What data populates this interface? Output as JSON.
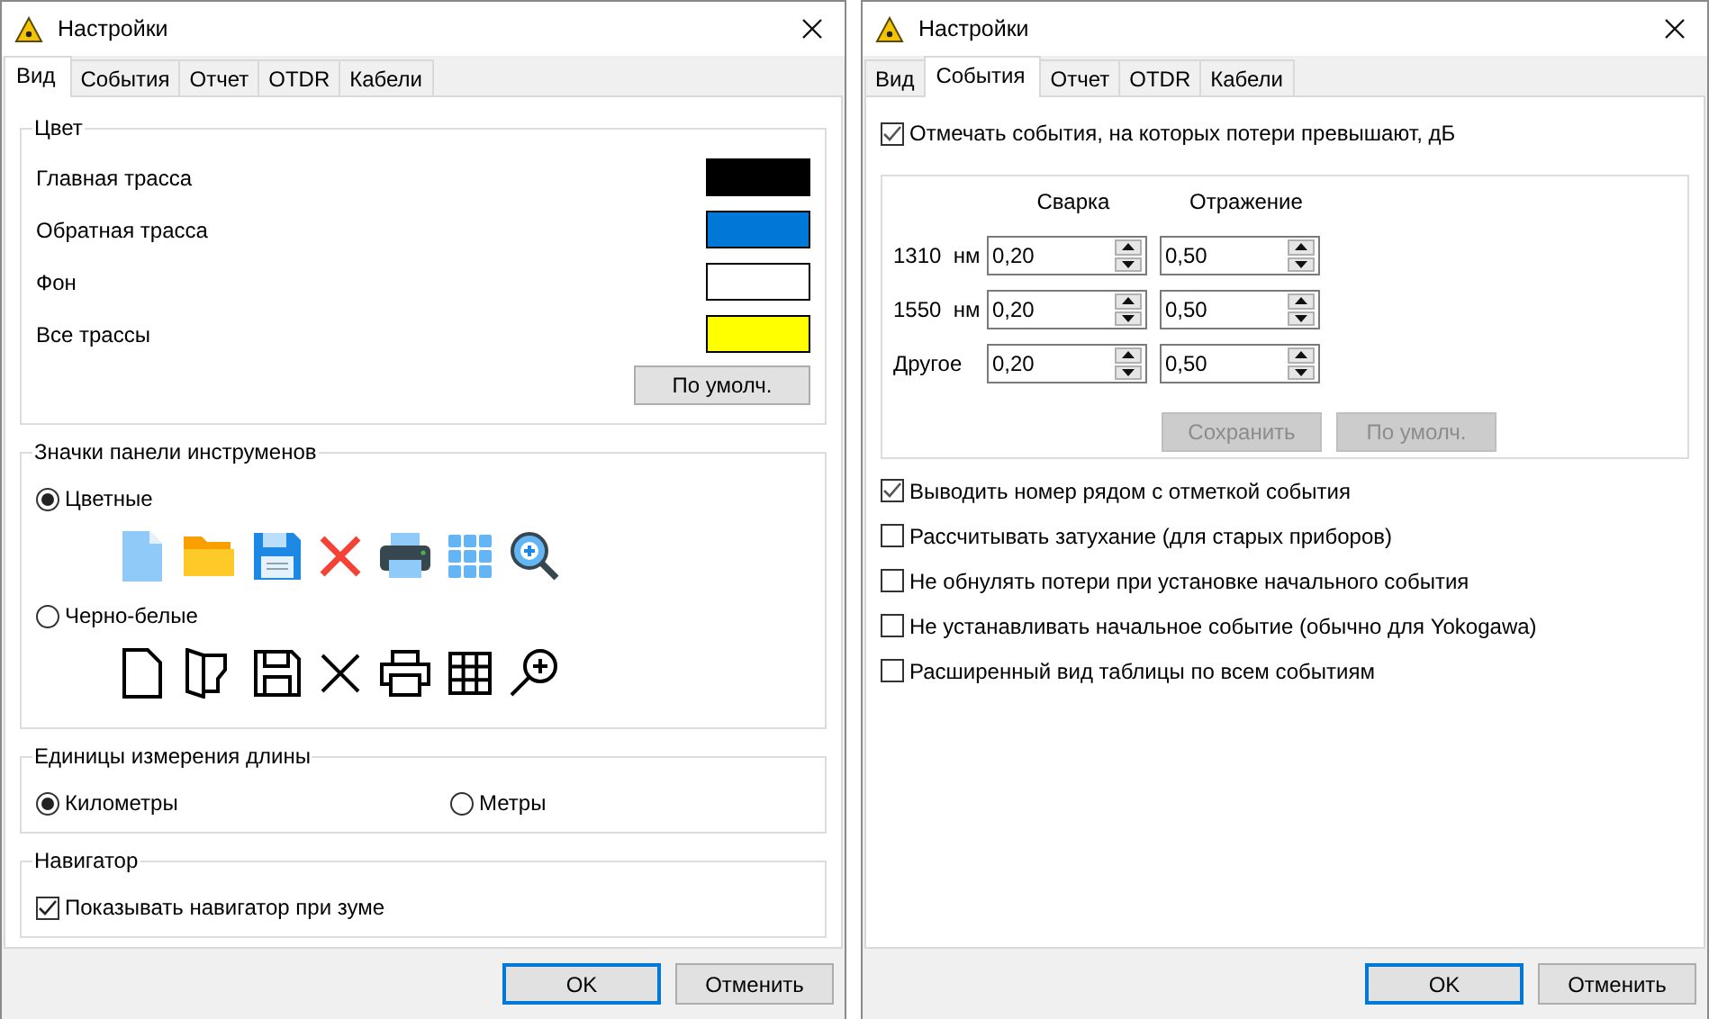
{
  "dialogs": [
    {
      "kind": "view",
      "title": "Настройки",
      "tabs": [
        {
          "label": "Вид",
          "selected": true
        },
        {
          "label": "События",
          "selected": false
        },
        {
          "label": "Отчет",
          "selected": false
        },
        {
          "label": "OTDR",
          "selected": false
        },
        {
          "label": "Кабели",
          "selected": false
        }
      ],
      "color_group": {
        "title": "Цвет",
        "items": [
          {
            "label": "Главная трасса",
            "color": "#000000"
          },
          {
            "label": "Обратная трасса",
            "color": "#0078d7"
          },
          {
            "label": "Фон",
            "color": "#ffffff"
          },
          {
            "label": "Все трассы",
            "color": "#ffff00"
          }
        ],
        "default_button": "По умолч."
      },
      "icons_group": {
        "title": "Значки панели инструменов",
        "options": [
          {
            "label": "Цветные",
            "selected": true,
            "kind": "color"
          },
          {
            "label": "Черно-белые",
            "selected": false,
            "kind": "mono"
          }
        ]
      },
      "units_group": {
        "title": "Единицы измерения длины",
        "options": [
          {
            "label": "Километры",
            "selected": true
          },
          {
            "label": "Метры",
            "selected": false
          }
        ]
      },
      "navigator_group": {
        "title": "Навигатор",
        "checkbox": {
          "label": "Показывать навигатор при зуме",
          "checked": true
        }
      },
      "buttons": [
        {
          "label": "OK",
          "default": true
        },
        {
          "label": "Отменить",
          "default": false
        }
      ]
    },
    {
      "kind": "events",
      "title": "Настройки",
      "tabs": [
        {
          "label": "Вид",
          "selected": false
        },
        {
          "label": "События",
          "selected": true
        },
        {
          "label": "Отчет",
          "selected": false
        },
        {
          "label": "OTDR",
          "selected": false
        },
        {
          "label": "Кабели",
          "selected": false
        }
      ],
      "threshold": {
        "label": "Отмечать события, на которых потери превышают, дБ",
        "checked": true
      },
      "grid": {
        "columns": [
          "Сварка",
          "Отражение"
        ],
        "rows": [
          {
            "label": "1310  нм",
            "values": [
              "0,20",
              "0,50"
            ]
          },
          {
            "label": "1550  нм",
            "values": [
              "0,20",
              "0,50"
            ]
          },
          {
            "label": "Другое",
            "values": [
              "0,20",
              "0,50"
            ]
          }
        ],
        "buttons": [
          {
            "label": "Сохранить",
            "disabled": true
          },
          {
            "label": "По умолч.",
            "disabled": true
          }
        ]
      },
      "options": [
        {
          "label": "Выводить номер рядом с отметкой события",
          "checked": true
        },
        {
          "label": "Рассчитывать затухание (для старых приборов)",
          "checked": false
        },
        {
          "label": "Не обнулять потери при установке начального события",
          "checked": false
        },
        {
          "label": "Не устанавливать начальное событие (обычно для Yokogawa)",
          "checked": false
        },
        {
          "label": "Расширенный вид таблицы по всем событиям",
          "checked": false
        }
      ],
      "buttons": [
        {
          "label": "OK",
          "default": true
        },
        {
          "label": "Отменить",
          "default": false
        }
      ]
    }
  ]
}
